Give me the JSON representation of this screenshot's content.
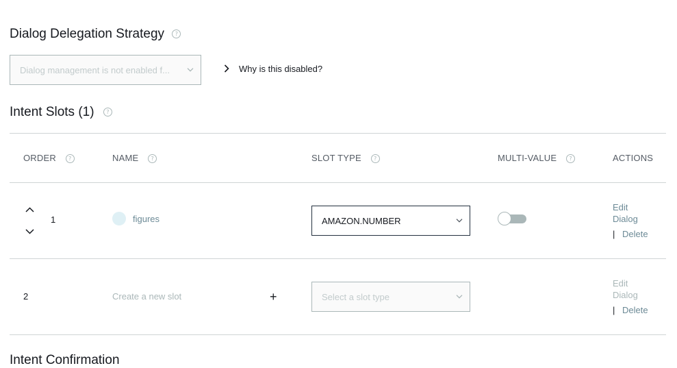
{
  "delegation": {
    "title": "Dialog Delegation Strategy",
    "help": "?",
    "select_value": "Dialog management is not enabled f...",
    "why_label": "Why is this disabled?"
  },
  "slots": {
    "title": "Intent Slots (1)",
    "help": "?",
    "headers": {
      "order": "ORDER",
      "name": "NAME",
      "slot_type": "SLOT TYPE",
      "multi_value": "MULTI-VALUE",
      "actions": "ACTIONS"
    },
    "rows": [
      {
        "order": "1",
        "name": "figures",
        "slot_type": "AMAZON.NUMBER",
        "multi_value": false,
        "edit": "Edit Dialog",
        "separator": "|",
        "delete": "Delete"
      },
      {
        "order": "2",
        "name_placeholder": "Create a new slot",
        "add_symbol": "+",
        "slot_type_placeholder": "Select a slot type",
        "edit": "Edit Dialog",
        "separator": "|",
        "delete": "Delete"
      }
    ]
  },
  "next_section": {
    "title": "Intent Confirmation"
  }
}
